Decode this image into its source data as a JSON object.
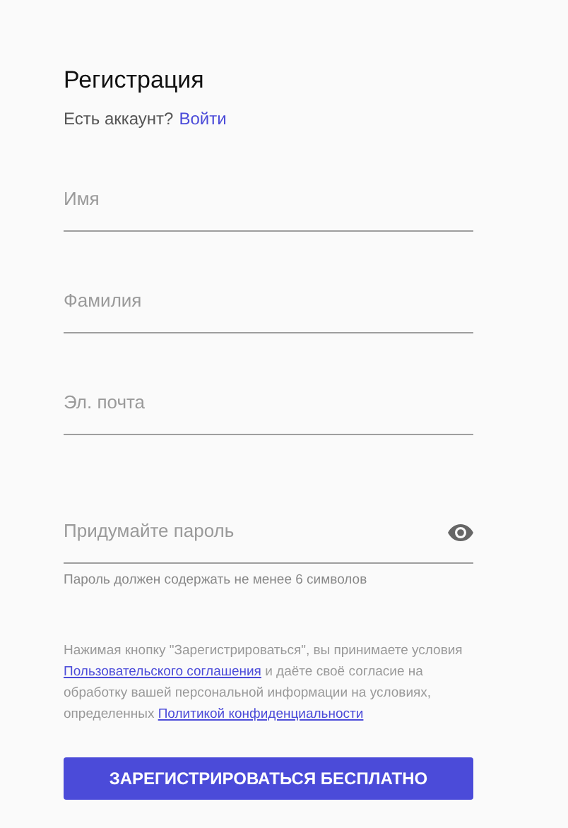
{
  "title": "Регистрация",
  "login_prompt": {
    "text": "Есть аккаунт?",
    "link": "Войти"
  },
  "fields": [
    {
      "kind": "text",
      "placeholder": "Имя"
    },
    {
      "kind": "text",
      "placeholder": "Фамилия"
    },
    {
      "kind": "text",
      "placeholder": "Эл. почта"
    },
    {
      "kind": "password",
      "placeholder": "Придумайте пароль",
      "hint": "Пароль должен содержать не менее 6 символов"
    }
  ],
  "consent": [
    {
      "kind": "text",
      "text": "Нажимая кнопку \"Зарегистрироваться\", вы принимаете условия"
    },
    {
      "kind": "link",
      "text": "Пользовательского соглашения"
    },
    {
      "kind": "text",
      "text": "и даёте своё согласие на обработку вашей персональной информации на условиях, определенных"
    },
    {
      "kind": "link",
      "text": "Политикой конфиденциальности"
    }
  ],
  "submit_button": "ЗАРЕГИСТРИРОВАТЬСЯ БЕСПЛАТНО"
}
